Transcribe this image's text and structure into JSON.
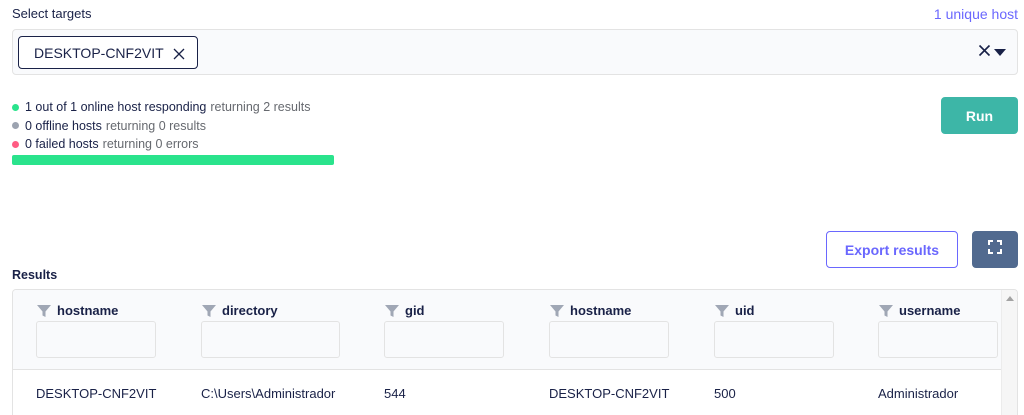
{
  "header": {
    "select_targets_label": "Select targets",
    "unique_host_label": "1 unique host"
  },
  "targets": {
    "chips": [
      {
        "label": "DESKTOP-CNF2VIT"
      }
    ]
  },
  "status": {
    "online": {
      "text": "1 out of 1 online host responding",
      "suffix": "returning 2 results",
      "color": "#2ae38c"
    },
    "offline": {
      "text": "0 offline hosts",
      "suffix": "returning 0 results",
      "color": "#9ca3b0"
    },
    "failed": {
      "text": "0 failed hosts",
      "suffix": "returning 0 errors",
      "color": "#ff5c83"
    },
    "progress_fraction": 1.0
  },
  "actions": {
    "run_label": "Run",
    "export_label": "Export results",
    "fullscreen_icon": "fullscreen-icon"
  },
  "results": {
    "label": "Results",
    "columns": [
      "hostname",
      "directory",
      "gid",
      "hostname",
      "uid",
      "username"
    ],
    "rows": [
      [
        "DESKTOP-CNF2VIT",
        "C:\\Users\\Administrador",
        "544",
        "DESKTOP-CNF2VIT",
        "500",
        "Administrador"
      ]
    ]
  },
  "colors": {
    "accent": "#6a67fe",
    "run": "#3db6a7",
    "fullscreen": "#516a8f",
    "text": "#192147"
  }
}
